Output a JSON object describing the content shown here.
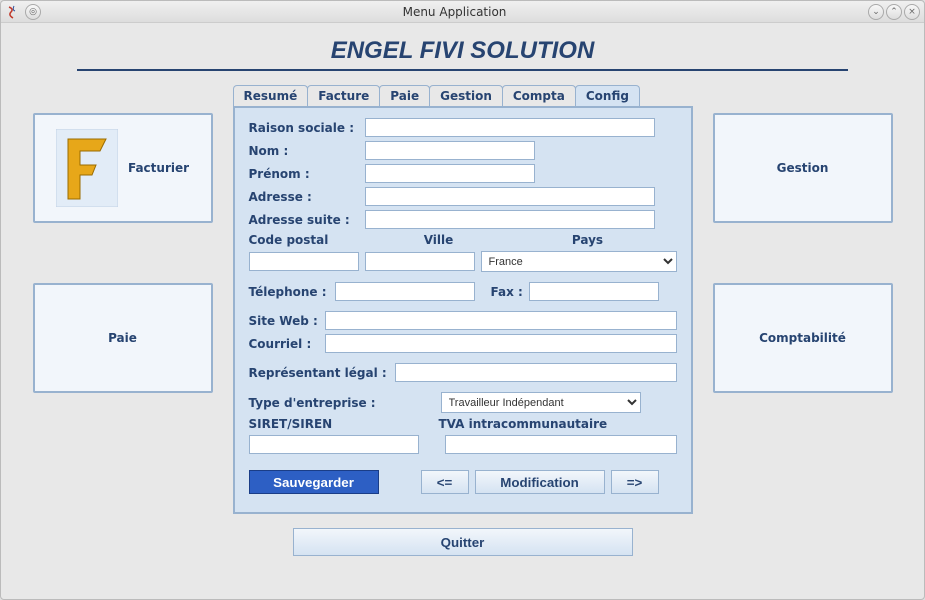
{
  "window": {
    "title": "Menu Application"
  },
  "header": {
    "brand": "ENGEL FIVI SOLUTION"
  },
  "side_left": [
    {
      "label": "Facturier",
      "icon": "F-logo"
    },
    {
      "label": "Paie",
      "icon": null
    }
  ],
  "side_right": [
    {
      "label": "Gestion"
    },
    {
      "label": "Comptabilité"
    }
  ],
  "tabs": [
    {
      "label": "Resumé"
    },
    {
      "label": "Facture"
    },
    {
      "label": "Paie"
    },
    {
      "label": "Gestion"
    },
    {
      "label": "Compta"
    },
    {
      "label": "Config",
      "active": true
    }
  ],
  "config_form": {
    "fields": {
      "raison_sociale": {
        "label": "Raison sociale :",
        "value": ""
      },
      "nom": {
        "label": "Nom  :",
        "value": ""
      },
      "prenom": {
        "label": "Prénom :",
        "value": ""
      },
      "adresse": {
        "label": "Adresse :",
        "value": ""
      },
      "adresse_suite": {
        "label": "Adresse suite :",
        "value": ""
      },
      "code_postal": {
        "label": "Code postal",
        "value": ""
      },
      "ville": {
        "label": "Ville",
        "value": ""
      },
      "pays": {
        "label": "Pays",
        "value": "France"
      },
      "telephone": {
        "label": "Télephone :",
        "value": ""
      },
      "fax": {
        "label": "Fax :",
        "value": ""
      },
      "site_web": {
        "label": "Site Web :",
        "value": ""
      },
      "courriel": {
        "label": "Courriel :",
        "value": ""
      },
      "representant": {
        "label": "Représentant légal :",
        "value": ""
      },
      "type_entreprise": {
        "label": "Type d'entreprise :",
        "value": "Travailleur Indépendant"
      },
      "siret": {
        "label": "SIRET/SIREN",
        "value": ""
      },
      "tva": {
        "label": "TVA intracommunautaire",
        "value": ""
      }
    },
    "buttons": {
      "save": "Sauvegarder",
      "prev": "<=",
      "modification": "Modification",
      "next": "=>"
    }
  },
  "footer": {
    "quit": "Quitter"
  }
}
